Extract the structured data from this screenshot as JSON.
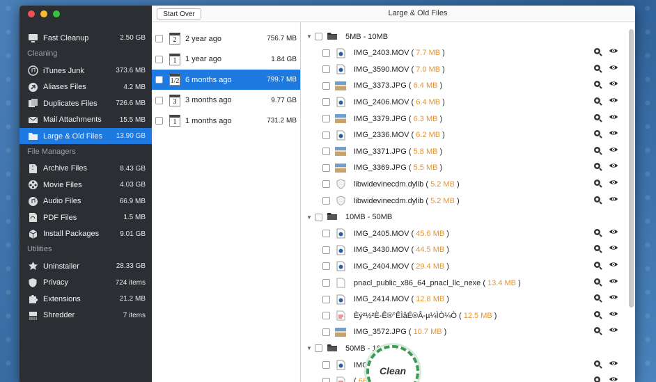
{
  "window": {
    "title": "Large & Old Files",
    "start_over": "Start Over"
  },
  "sidebar": {
    "top": {
      "label": "Fast Cleanup",
      "size": "2.50 GB",
      "icon": "monitor-icon"
    },
    "sections": [
      {
        "title": "Cleaning",
        "items": [
          {
            "label": "iTunes Junk",
            "size": "373.6 MB",
            "icon": "music-icon"
          },
          {
            "label": "Aliases Files",
            "size": "4.2 MB",
            "icon": "alias-icon"
          },
          {
            "label": "Duplicates Files",
            "size": "726.6 MB",
            "icon": "duplicate-icon"
          },
          {
            "label": "Mail Attachments",
            "size": "15.5 MB",
            "icon": "mail-icon"
          },
          {
            "label": "Large & Old Files",
            "size": "13.90 GB",
            "icon": "folder-icon",
            "active": true
          }
        ]
      },
      {
        "title": "File Managers",
        "items": [
          {
            "label": "Archive Files",
            "size": "8.43 GB",
            "icon": "archive-icon"
          },
          {
            "label": "Movie Files",
            "size": "4.03 GB",
            "icon": "film-reel-icon"
          },
          {
            "label": "Audio Files",
            "size": "66.9 MB",
            "icon": "audio-icon"
          },
          {
            "label": "PDF Files",
            "size": "1.5 MB",
            "icon": "pdf-icon"
          },
          {
            "label": "Install Packages",
            "size": "9.01 GB",
            "icon": "package-icon"
          }
        ]
      },
      {
        "title": "Utilities",
        "items": [
          {
            "label": "Uninstaller",
            "size": "28.33 GB",
            "icon": "uninstaller-icon"
          },
          {
            "label": "Privacy",
            "size": "724 items",
            "icon": "shield-icon"
          },
          {
            "label": "Extensions",
            "size": "21.2 MB",
            "icon": "puzzle-icon"
          },
          {
            "label": "Shredder",
            "size": "7 items",
            "icon": "shredder-icon"
          }
        ]
      }
    ]
  },
  "ages": [
    {
      "cal": "2",
      "label": "2 year ago",
      "size": "756.7 MB"
    },
    {
      "cal": "1",
      "label": "1 year ago",
      "size": "1.84 GB"
    },
    {
      "cal": "1/2",
      "label": "6 months ago",
      "size": "799.7 MB",
      "active": true
    },
    {
      "cal": "3",
      "label": "3 months ago",
      "size": "9.77 GB"
    },
    {
      "cal": "1",
      "label": "1 months ago",
      "size": "731.2 MB"
    }
  ],
  "groups": [
    {
      "label": "5MB - 10MB",
      "files": [
        {
          "name": "IMG_2403.MOV",
          "size": "7.7 MB",
          "icon": "movie-file-icon"
        },
        {
          "name": "IMG_3590.MOV",
          "size": "7.0 MB",
          "icon": "movie-file-icon"
        },
        {
          "name": "IMG_3373.JPG",
          "size": "6.4 MB",
          "icon": "image-thumbnail-icon"
        },
        {
          "name": "IMG_2406.MOV",
          "size": "6.4 MB",
          "icon": "movie-file-icon"
        },
        {
          "name": "IMG_3379.JPG",
          "size": "6.3 MB",
          "icon": "image-thumbnail-icon"
        },
        {
          "name": "IMG_2336.MOV",
          "size": "6.2 MB",
          "icon": "movie-file-icon"
        },
        {
          "name": "IMG_3371.JPG",
          "size": "5.8 MB",
          "icon": "image-thumbnail-icon"
        },
        {
          "name": "IMG_3369.JPG",
          "size": "5.5 MB",
          "icon": "image-thumbnail-icon"
        },
        {
          "name": "libwidevinecdm.dylib",
          "size": "5.2 MB",
          "icon": "library-file-icon"
        },
        {
          "name": "libwidevinecdm.dylib",
          "size": "5.2 MB",
          "icon": "library-file-icon"
        }
      ]
    },
    {
      "label": "10MB - 50MB",
      "files": [
        {
          "name": "IMG_2405.MOV",
          "size": "45.6 MB",
          "icon": "movie-file-icon"
        },
        {
          "name": "IMG_3430.MOV",
          "size": "44.5 MB",
          "icon": "movie-file-icon"
        },
        {
          "name": "IMG_2404.MOV",
          "size": "29.4 MB",
          "icon": "movie-file-icon"
        },
        {
          "name": "pnacl_public_x86_64_pnacl_llc_nexe",
          "size": "13.4 MB",
          "icon": "document-icon"
        },
        {
          "name": "IMG_2414.MOV",
          "size": "12.8 MB",
          "icon": "movie-file-icon"
        },
        {
          "name": "Èý²½²È-Ê®°ÊÌåÉ®Â-µ¼ÌÒ¼Ò",
          "size": "12.5 MB",
          "icon": "text-file-icon"
        },
        {
          "name": "IMG_3572.JPG",
          "size": "10.7 MB",
          "icon": "image-thumbnail-icon"
        }
      ]
    },
    {
      "label": "50MB - 100MB",
      "files": [
        {
          "name": "IMG",
          "size": "1 MB",
          "icon": "movie-file-icon"
        },
        {
          "name": "",
          "size": "66.3 MB",
          "icon": "text-file-icon"
        }
      ]
    }
  ],
  "clean_button": "Clean",
  "colors": {
    "accent": "#1e7ae0",
    "size_text": "#e8922a",
    "sidebar_bg": "#2b2f34"
  }
}
